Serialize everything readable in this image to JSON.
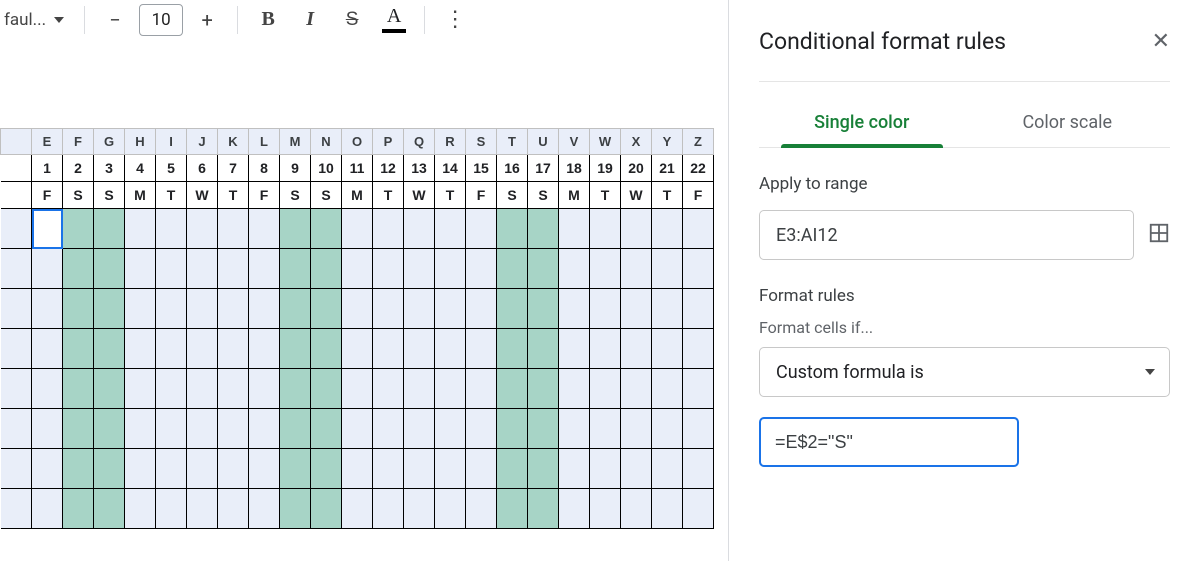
{
  "toolbar": {
    "font_name": "faul...",
    "font_size": "10",
    "bold_glyph": "B",
    "italic_glyph": "I",
    "strike_glyph": "S",
    "textcolor_glyph": "A",
    "more_glyph": "⋮"
  },
  "sheet": {
    "columns": [
      "E",
      "F",
      "G",
      "H",
      "I",
      "J",
      "K",
      "L",
      "M",
      "N",
      "O",
      "P",
      "Q",
      "R",
      "S",
      "T",
      "U",
      "V",
      "W",
      "X",
      "Y",
      "Z"
    ],
    "row_numbers": [
      "1",
      "2",
      "3",
      "4",
      "5",
      "6",
      "7",
      "8",
      "9",
      "10",
      "11",
      "12",
      "13",
      "14",
      "15",
      "16",
      "17",
      "18",
      "19",
      "20",
      "21",
      "22"
    ],
    "weekdays": [
      "F",
      "S",
      "S",
      "M",
      "T",
      "W",
      "T",
      "F",
      "S",
      "S",
      "M",
      "T",
      "W",
      "T",
      "F",
      "S",
      "S",
      "M",
      "T",
      "W",
      "T",
      "F"
    ],
    "sat_columns_idx": [
      1,
      2,
      8,
      9,
      15,
      16
    ],
    "body_row_count": 8
  },
  "sidepanel": {
    "title": "Conditional format rules",
    "tabs": {
      "single": "Single color",
      "scale": "Color scale"
    },
    "apply_label": "Apply to range",
    "range_value": "E3:AI12",
    "rules_label": "Format rules",
    "cells_if_label": "Format cells if...",
    "condition_selected": "Custom formula is",
    "formula_value": "=E$2=\"S\""
  }
}
